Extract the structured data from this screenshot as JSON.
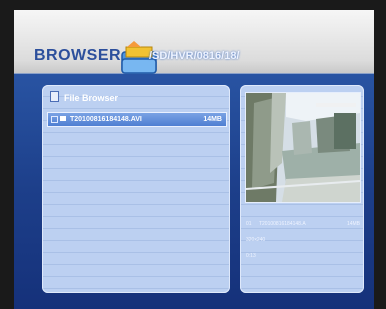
{
  "header": {
    "title": "BROWSER",
    "path": "/SD/HVR/0816/18/"
  },
  "browser": {
    "title": "File Browser",
    "files": [
      {
        "name": "T20100816184148.AVI",
        "size": "14MB"
      }
    ]
  },
  "preview": {
    "file_info": {
      "index": "01",
      "name": "T20100816184148.A",
      "size": "14MB"
    },
    "resolution": "320x240",
    "duration": "0:13"
  },
  "colors": {
    "accent": "#2c4f9c",
    "panel": "#bcd0f1",
    "selected_row": "#5a88d6"
  }
}
